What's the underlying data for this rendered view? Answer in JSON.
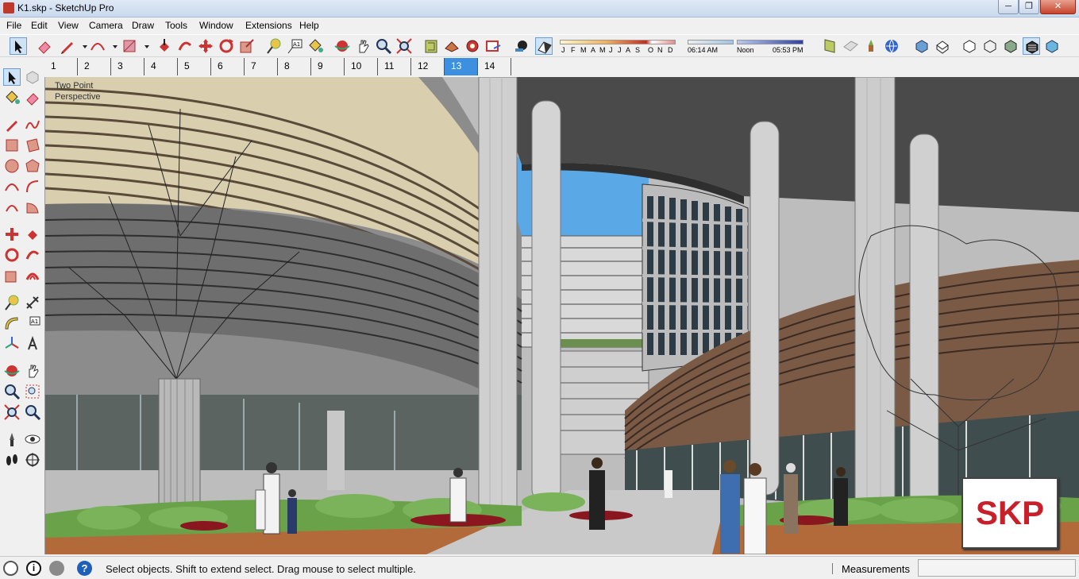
{
  "window": {
    "title": "K1.skp - SketchUp Pro",
    "controls": {
      "minimize": "─",
      "maximize": "❐",
      "close": "✕"
    }
  },
  "menu": [
    "File",
    "Edit",
    "View",
    "Camera",
    "Draw",
    "Tools",
    "Window",
    "Extensions",
    "Help"
  ],
  "shadows": {
    "months": [
      "J",
      "F",
      "M",
      "A",
      "M",
      "J",
      "J",
      "A",
      "S",
      "O",
      "N",
      "D"
    ],
    "time_start": "06:14 AM",
    "time_mid": "Noon",
    "time_end": "05:53 PM"
  },
  "scenes": {
    "tabs": [
      "1",
      "2",
      "3",
      "4",
      "5",
      "6",
      "7",
      "8",
      "9",
      "10",
      "11",
      "12",
      "13",
      "14"
    ],
    "selected": "13"
  },
  "viewport": {
    "overlay_line1": "Two Point",
    "overlay_line2": "Perspective",
    "badge": "SKP"
  },
  "status": {
    "hint": "Select objects. Shift to extend select. Drag mouse to select multiple.",
    "measurements_label": "Measurements",
    "measurements_value": ""
  },
  "colors": {
    "selected_tab": "#3d8fe0",
    "badge_text": "#c8202a",
    "sky": "#5aa9e6",
    "pillar": "#cfcfcf"
  }
}
